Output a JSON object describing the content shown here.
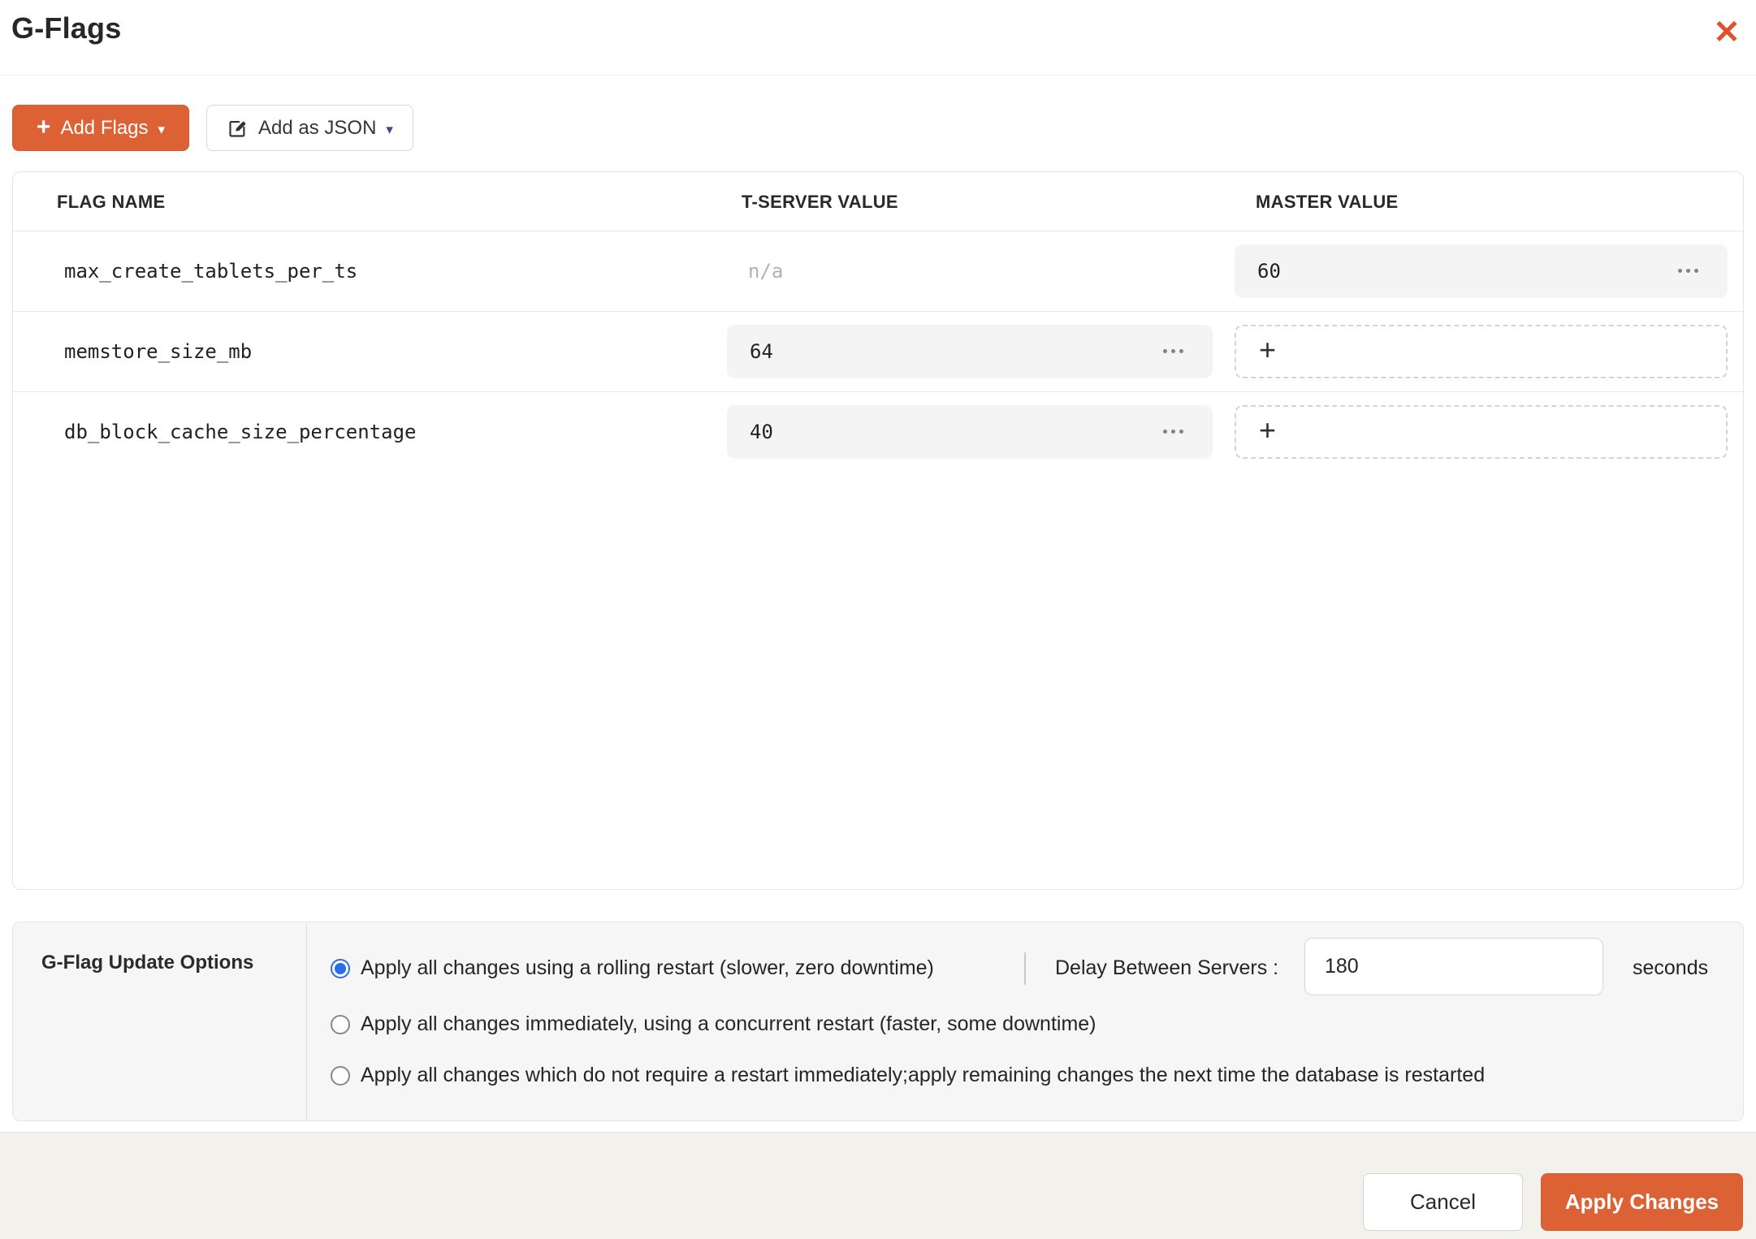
{
  "modal": {
    "title": "G-Flags",
    "close_glyph": "✕"
  },
  "toolbar": {
    "add_flags_label": "Add Flags",
    "add_as_json_label": "Add as JSON",
    "plus_glyph": "+",
    "caret_glyph": "▾"
  },
  "table": {
    "columns": {
      "flag_name": "FLAG NAME",
      "tserver": "T-SERVER VALUE",
      "master": "MASTER VALUE"
    },
    "rows": [
      {
        "flag_name": "max_create_tablets_per_ts",
        "tserver_value": "n/a",
        "master_value": "60"
      },
      {
        "flag_name": "memstore_size_mb",
        "tserver_value": "64",
        "master_add_glyph": "+"
      },
      {
        "flag_name": "db_block_cache_size_percentage",
        "tserver_value": "40",
        "master_add_glyph": "+"
      }
    ]
  },
  "options": {
    "title": "G-Flag Update Options",
    "radios": [
      {
        "label": "Apply all changes using a rolling restart (slower, zero downtime)",
        "selected": true
      },
      {
        "label": "Apply all changes immediately, using a concurrent restart (faster, some downtime)",
        "selected": false
      },
      {
        "label": "Apply all changes which do not require a restart immediately;apply remaining changes the next time the database is restarted",
        "selected": false
      }
    ],
    "delay_label": "Delay Between Servers :",
    "delay_value": "180",
    "delay_unit": "seconds"
  },
  "footer": {
    "cancel_label": "Cancel",
    "apply_label": "Apply Changes"
  },
  "colors": {
    "accent_orange": "#dc6236",
    "close_orange": "#de532f",
    "radio_selected_blue": "#2b6de9",
    "value_box_gray": "#f4f4f5",
    "panel_gray": "#f6f6f6",
    "footer_beige": "#f2f1eb"
  }
}
